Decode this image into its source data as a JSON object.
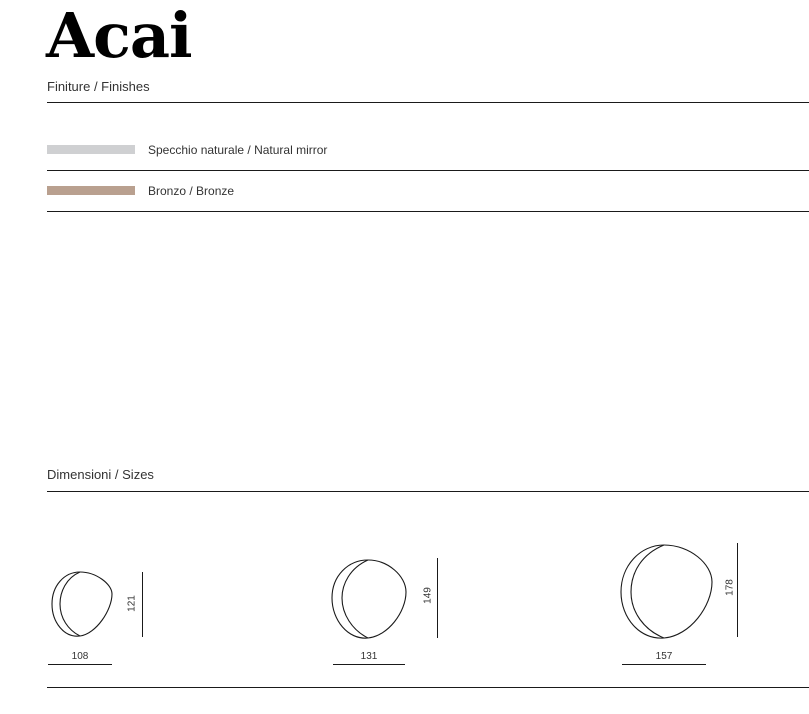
{
  "title": "Acai",
  "finishes": {
    "heading": "Finiture / Finishes",
    "items": [
      {
        "label": "Specchio naturale / Natural mirror",
        "color": "#cfd0d2"
      },
      {
        "label": "Bronzo / Bronze",
        "color": "#b9a08f"
      }
    ]
  },
  "sizes": {
    "heading": "Dimensioni / Sizes",
    "items": [
      {
        "width": "108",
        "height": "121"
      },
      {
        "width": "131",
        "height": "149"
      },
      {
        "width": "157",
        "height": "178"
      }
    ]
  }
}
